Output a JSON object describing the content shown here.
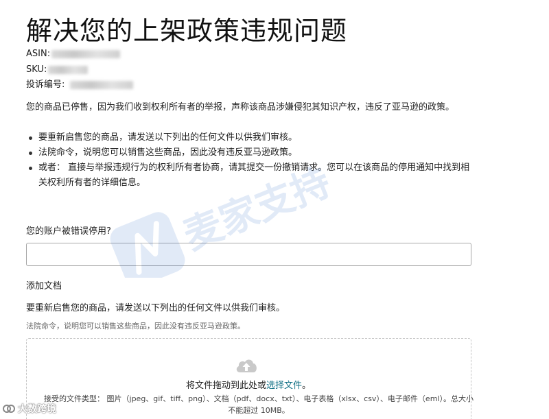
{
  "page": {
    "title": "解决您的上架政策违规问题",
    "asin_label": "ASIN:",
    "sku_label": "SKU:",
    "complaint_label": "投诉编号:",
    "notice": "您的商品已停售，因为我们收到权利所有者的举报，声称该商品涉嫌侵犯其知识产权，违反了亚马逊的政策。",
    "bullets": [
      "要重新启售您的商品，请发送以下列出的任何文件以供我们审核。",
      "法院命令，说明您可以销售这些商品，因此没有违反亚马逊政策。",
      "或者： 直接与举报违规行为的权利所有者协商，请其提交一份撤销请求。您可以在该商品的停用通知中找到相关权利所有者的详细信息。"
    ],
    "question_label": "您的账户被错误停用?",
    "question_value": "",
    "add_docs_label": "添加文档",
    "resubmit_text": "要重新启售您的商品，请发送以下列出的任何文件以供我们审核。",
    "court_note": "法院命令，说明您可以销售这些商品，因此没有违反亚马逊政策。",
    "upload": {
      "drag_text": "将文件拖动到此处或",
      "choose_link": "选择文件",
      "drag_suffix": "。",
      "accepted_types": "接受的文件类型： 图片（jpeg、gif、tiff、png）、文档（pdf、docx、txt）、电子表格（xlsx、csv）、电子邮件（eml）。总大小不能超过 10MB。",
      "icon": "cloud-upload-icon"
    },
    "watermark": {
      "text": "麦家支持",
      "color": "#4a7fd4"
    },
    "corner_watermark": {
      "text": "大数跨境",
      "icon": "logo-icon"
    },
    "colors": {
      "link": "#0f6f84",
      "input_border": "#a6a6a6",
      "dropzone_border": "#c4c4c4"
    }
  }
}
